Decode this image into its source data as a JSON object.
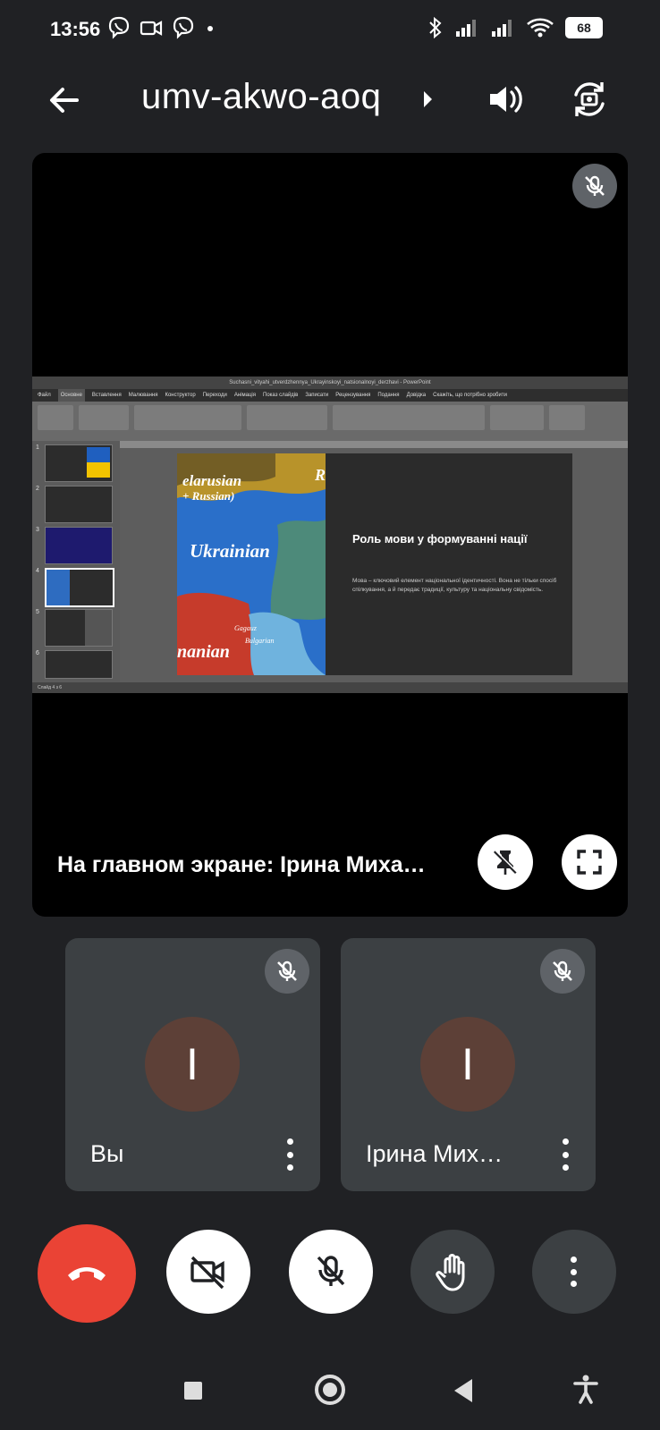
{
  "status_bar": {
    "time": "13:56",
    "battery": "68",
    "icons": [
      "viber-icon",
      "video-call-icon",
      "viber-icon",
      "dot-icon",
      "bluetooth-icon",
      "signal-icon",
      "signal-icon",
      "wifi-icon",
      "battery-icon"
    ]
  },
  "top_bar": {
    "meeting_code": "umv-akwo-aoq",
    "back_icon": "arrow-left-icon",
    "speaker_icon": "volume-icon",
    "switch_camera_icon": "camera-switch-icon"
  },
  "stage": {
    "presenting_label": "На главном экране: Ірина Миха…",
    "ppt": {
      "window_title": "Suchasni_vityahi_utverdzhennya_Ukrayinskoyi_natsionalnoyi_derzhavi - PowerPoint",
      "tabs": [
        "Файл",
        "Основне",
        "Вставлення",
        "Малювання",
        "Конструктор",
        "Переходи",
        "Анімація",
        "Показ слайдів",
        "Записати",
        "Рецензування",
        "Подання",
        "Довідка",
        "Скажіть, що потрібно зробити"
      ],
      "thumb_numbers": [
        "1",
        "2",
        "3",
        "4",
        "5",
        "6"
      ],
      "status_text": "Слайд 4 з 6",
      "slide": {
        "map_label_1": "elarusian",
        "map_label_2": "+ Russian)",
        "map_label_3": "Ukrainian",
        "map_label_4": "nanian",
        "map_label_5": "Gagauz",
        "map_label_6": "Bulgarian",
        "map_label_7": "R",
        "title": "Роль мови у формуванні нації",
        "body": "Мова – ключовий елемент національної ідентичності. Вона не тільки спосіб спілкування, а й передає традиції, культуру та національну свідомість."
      }
    }
  },
  "participants": [
    {
      "name": "Вы",
      "initial": "I",
      "avatar_color": "#5d4037"
    },
    {
      "name": "Ірина Мих…",
      "initial": "I",
      "avatar_color": "#5d4037"
    }
  ],
  "controls": {
    "end_call_color": "#ea4335",
    "icons": [
      "phone-end-icon",
      "camera-off-icon",
      "mic-off-icon",
      "raise-hand-icon",
      "more-vert-icon"
    ]
  }
}
